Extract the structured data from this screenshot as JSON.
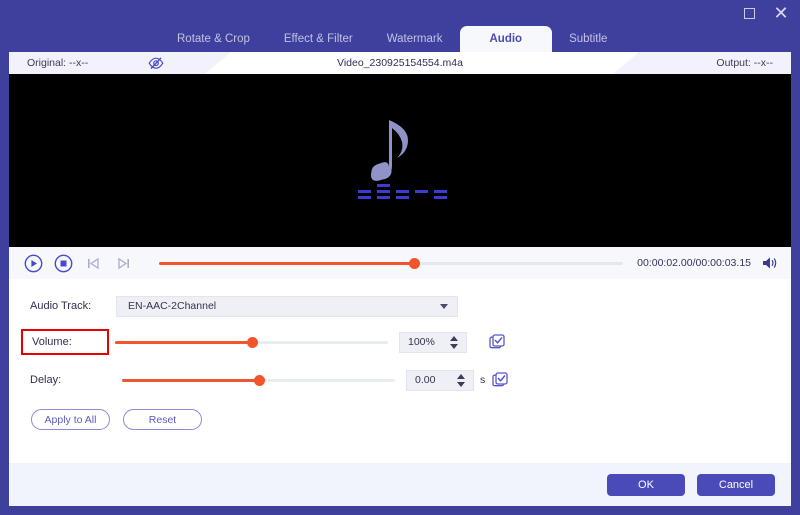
{
  "titlebar": {
    "maximize_icon": "maximize-icon",
    "close_icon": "close-icon"
  },
  "tabs": [
    {
      "label": "Rotate & Crop",
      "active": false
    },
    {
      "label": "Effect & Filter",
      "active": false
    },
    {
      "label": "Watermark",
      "active": false
    },
    {
      "label": "Audio",
      "active": true
    },
    {
      "label": "Subtitle",
      "active": false
    }
  ],
  "infobar": {
    "original_label": "Original: --x--",
    "eye_icon": "eye-hidden-icon",
    "filename": "Video_230925154554.m4a",
    "output_label": "Output: --x--"
  },
  "preview": {
    "icon": "music-note-icon",
    "note_color": "#8f93c8",
    "bars_color": "#3b3bd6",
    "background": "#000000"
  },
  "player": {
    "play_icon": "play-circle-icon",
    "stop_icon": "stop-circle-icon",
    "prev_icon": "previous-frame-icon",
    "next_icon": "next-frame-icon",
    "timeline_percent": 55,
    "timecode": "00:00:02.00/00:00:03.15",
    "volume_icon": "speaker-icon"
  },
  "form": {
    "audio_track": {
      "label": "Audio Track:",
      "value": "EN-AAC-2Channel",
      "caret_icon": "chevron-down-icon"
    },
    "volume": {
      "label": "Volume:",
      "highlighted": true,
      "highlight_color": "#e60000",
      "slider_percent": 50,
      "value": "100%",
      "apply_icon": "apply-check-icon"
    },
    "delay": {
      "label": "Delay:",
      "slider_percent": 50,
      "value": "0.00",
      "unit": "s",
      "apply_icon": "apply-check-icon"
    },
    "buttons": {
      "apply_to_all": "Apply to All",
      "reset": "Reset"
    }
  },
  "footer": {
    "ok": "OK",
    "cancel": "Cancel"
  },
  "theme": {
    "chrome": "#3f3f9e",
    "accent_slider": "#f2542d",
    "button_primary": "#4a4ab8"
  }
}
